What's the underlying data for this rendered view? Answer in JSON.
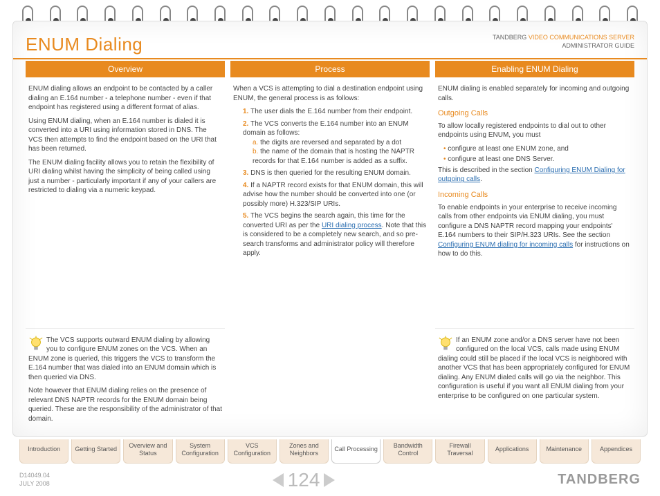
{
  "header": {
    "title": "ENUM Dialing",
    "brand_pre": "TANDBERG ",
    "brand_orange": "VIDEO COMMUNICATIONS SERVER",
    "brand_sub": "ADMINISTRATOR GUIDE"
  },
  "columns": [
    {
      "head": "Overview",
      "paras": [
        "ENUM dialing allows an endpoint to be contacted by a caller dialing an E.164 number - a telephone number - even if that endpoint has registered using a different format of alias.",
        "Using ENUM dialing, when an E.164 number is dialed it is converted into a URI using information stored in DNS.  The VCS then attempts to find the endpoint based on the URI that has been returned.",
        "The ENUM dialing facility allows you to retain the flexibility of URI dialing whilst having the simplicity of being called using just a number - particularly important if any of your callers are restricted to dialing via a numeric keypad."
      ]
    },
    {
      "head": "Process",
      "intro": "When a VCS is attempting to dial a destination endpoint using ENUM, the general process is as follows:",
      "steps": [
        "The user dials the E.164 number from their endpoint.",
        "The VCS converts the E.164 number into an ENUM domain as follows:",
        "DNS is then queried for the resulting ENUM domain.",
        "If a NAPTR record exists for that ENUM domain, this will advise how the number should be converted into one (or possibly more) H.323/SIP URIs."
      ],
      "substeps": [
        "the digits are reversed and separated by a dot",
        "the name of the domain that is hosting the NAPTR records for that E.164 number is added as a suffix."
      ],
      "step5_pre": "The VCS begins the search again, this time for the converted URI as per the ",
      "step5_link": "URI dialing process",
      "step5_post": ".  Note that this is considered to be a completely new search, and so pre-search transforms and administrator policy will therefore apply."
    },
    {
      "head": "Enabling ENUM Dialing",
      "intro": "ENUM dialing is enabled separately for incoming and outgoing calls.",
      "out_head": "Outgoing Calls",
      "out_intro": "To allow locally registered endpoints to dial out to other endpoints using ENUM, you must",
      "out_bullets": [
        "configure at least one ENUM zone, and",
        "configure at least one DNS Server."
      ],
      "out_desc_pre": "This is described in the section  ",
      "out_link": "Configuring ENUM Dialing for outgoing calls",
      "out_desc_post": ".",
      "in_head": "Incoming Calls",
      "in_pre": "To enable endpoints in your enterprise to receive incoming calls from other endpoints via ENUM dialing, you must configure a DNS NAPTR record mapping your endpoints' E.164 numbers to their SIP/H.323 URIs.  See the section ",
      "in_link": "Configuring ENUM dialing for incoming calls",
      "in_post": " for instructions on how to do this."
    }
  ],
  "tips": {
    "left_p1": "The VCS supports outward ENUM dialing by allowing you to configure ENUM zones on the VCS.  When an ENUM zone is queried, this triggers the VCS to transform the E.164 number that was dialed into an ENUM domain which is then queried via DNS.",
    "left_p2": "Note however that ENUM dialing relies on the presence of relevant DNS NAPTR records for the ENUM domain being queried.  These are the responsibility of the administrator of that domain.",
    "right": "If an ENUM zone and/or a DNS server have not been configured on the local VCS, calls made using ENUM dialing could still be placed if the local VCS is neighbored with another VCS that has been appropriately configured for ENUM dialing. Any ENUM dialed calls will go via the neighbor. This configuration is useful if you want all ENUM dialing from your enterprise to be configured on one particular system."
  },
  "tabs": [
    "Introduction",
    "Getting Started",
    "Overview and Status",
    "System Configuration",
    "VCS Configuration",
    "Zones and Neighbors",
    "Call Processing",
    "Bandwidth Control",
    "Firewall Traversal",
    "Applications",
    "Maintenance",
    "Appendices"
  ],
  "active_tab": 6,
  "footer": {
    "doc": "D14049.04",
    "date": "JULY 2008",
    "page": "124",
    "brand": "TANDBERG"
  }
}
